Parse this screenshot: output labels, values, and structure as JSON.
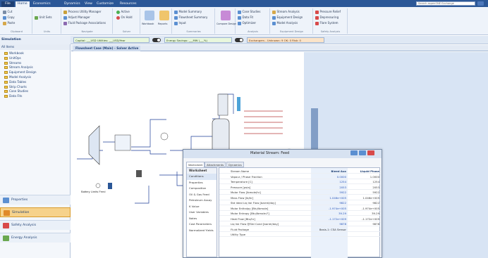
{
  "ribbon_tabs": [
    "File",
    "Home",
    "Economics",
    "Dynamics",
    "View",
    "Customize",
    "Resources"
  ],
  "search_placeholder": "Search aspenONE Exchange",
  "ribbon": {
    "clipboard": {
      "cut": "Cut",
      "copy": "Copy",
      "paste": "Paste",
      "label": "Clipboard"
    },
    "units": {
      "unit_set": "Unit Sets",
      "label": "Units"
    },
    "navigate": {
      "items": [
        "Process Utility Manager",
        "Adjust Manager",
        "Fluid Package Associations"
      ],
      "label": "Navigate"
    },
    "solver": {
      "active": "Active",
      "on_hold": "On Hold",
      "label": "Solver"
    },
    "reports": {
      "workbook": "Workbook",
      "reports": "Reports",
      "label": "Summaries"
    },
    "summaries": {
      "items": [
        "Model Summary",
        "Flowsheet Summary",
        "Input"
      ],
      "label": "Summaries"
    },
    "compare": {
      "label": "Compare Design"
    },
    "analysis": {
      "items": [
        "Case Studies",
        "Data Fit",
        "Optimizer"
      ],
      "label": "Analysis"
    },
    "stream_analysis": {
      "items": [
        "Stream Analysis",
        "Equipment Design",
        "Model Analysis"
      ],
      "label": "Equipment Design"
    },
    "safety": {
      "items": [
        "Pressure Relief",
        "Depressuring",
        "Flare System"
      ],
      "label": "Safety Analysis"
    }
  },
  "toolbar": {
    "nav_header": "Simulation",
    "capital": "Capital: ___USD  Utilities: ___USD/Year",
    "energy": "Energy Savings: ___MW (___%)",
    "exchangers": "Exchangers - Unknown: 9  OK: 0  Risk: 0"
  },
  "left_nav": {
    "all_items": "All Items",
    "tree": [
      "Workbook",
      "UnitOps",
      "Streams",
      "Stream Analysis",
      "Equipment Design",
      "Model Analysis",
      "Data Tables",
      "Strip Charts",
      "Case Studies",
      "Data Fits"
    ],
    "buttons": [
      "Properties",
      "Simulation",
      "Safety Analysis",
      "Energy Analysis"
    ],
    "selected": "Simulation"
  },
  "flowsheet_tab": "Flowsheet Case (Main) - Solver Active",
  "stream_label": "Battery Limits Feed",
  "window": {
    "title": "Material Stream: Feed",
    "tabs": [
      "Worksheet",
      "Attachments",
      "Dynamics"
    ],
    "side_header": "Worksheet",
    "side_items": [
      "Conditions",
      "Properties",
      "Composition",
      "Oil & Gas Feed",
      "Petroleum Assay",
      "K Value",
      "User Variables",
      "Notes",
      "Cost Parameters",
      "Normalized Yields"
    ],
    "selected_side": "Conditions",
    "col1": "Bleed Aux",
    "col2": "Liquid Phase",
    "rows": [
      {
        "name": "Stream Name",
        "v1": "Bleed Aux",
        "v2": "Liquid Phase"
      },
      {
        "name": "Vapour / Phase Fraction",
        "v1": "0.0000",
        "v2": "1.0000"
      },
      {
        "name": "Temperature [C]",
        "v1": "1254",
        "v2": "1254"
      },
      {
        "name": "Pressure [psia]",
        "v1": "2053",
        "v2": "2053"
      },
      {
        "name": "Molar Flow [lbmole/hr]",
        "v1": "5922",
        "v2": "5922"
      },
      {
        "name": "Mass Flow [lb/hr]",
        "v1": "1.046e+005",
        "v2": "1.046e+005"
      },
      {
        "name": "Std Ideal Liq Vol Flow [barrel/day]",
        "v1": "9822",
        "v2": "9822"
      },
      {
        "name": "Molar Enthalpy [Btu/lbmole]",
        "v1": "-1.974e+005",
        "v2": "-1.974e+005"
      },
      {
        "name": "Molar Entropy [Btu/lbmole-F]",
        "v1": "39.29",
        "v2": "39.29"
      },
      {
        "name": "Heat Flow [Btu/hr]",
        "v1": "-1.172e+009",
        "v2": "-1.172e+009"
      },
      {
        "name": "Liq Vol Flow @Std Cond [barrel/day]",
        "v1": "9878",
        "v2": "9878"
      },
      {
        "name": "Fluid Package",
        "v1": "Basis-1: CSA Sensor",
        "v2": ""
      },
      {
        "name": "Utility Type",
        "v1": "",
        "v2": ""
      }
    ]
  },
  "colors": {
    "accent": "#2b5797",
    "ribbon_bg": "#eef3fa",
    "nav_selected": "#f6d28b",
    "flowsheet_line": "#1f3f99",
    "stream_red": "#b83a3a"
  }
}
